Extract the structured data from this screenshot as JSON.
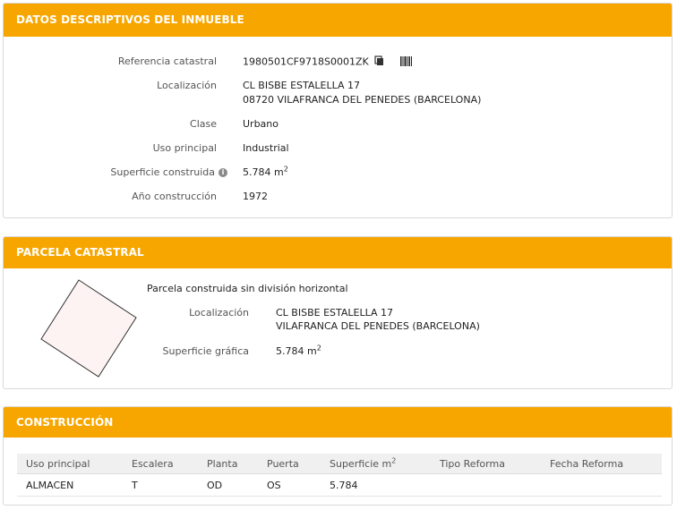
{
  "datos": {
    "title": "DATOS DESCRIPTIVOS DEL INMUEBLE",
    "ref_label": "Referencia catastral",
    "ref_value": "1980501CF9718S0001ZK",
    "loc_label": "Localización",
    "loc_line1": "CL BISBE ESTALELLA 17",
    "loc_line2": "08720 VILAFRANCA DEL PENEDES (BARCELONA)",
    "clase_label": "Clase",
    "clase_value": "Urbano",
    "uso_label": "Uso principal",
    "uso_value": "Industrial",
    "sup_label": "Superficie construida",
    "sup_value": "5.784 m",
    "sup_unit_exp": "2",
    "anio_label": "Año construcción",
    "anio_value": "1972"
  },
  "parcela": {
    "title": "PARCELA CATASTRAL",
    "desc": "Parcela construida sin división horizontal",
    "loc_label": "Localización",
    "loc_line1": "CL BISBE ESTALELLA 17",
    "loc_line2": "VILAFRANCA DEL PENEDES (BARCELONA)",
    "sup_label": "Superficie gráfica",
    "sup_value": "5.784 m",
    "sup_unit_exp": "2"
  },
  "construccion": {
    "title": "CONSTRUCCIÓN",
    "headers": [
      "Uso principal",
      "Escalera",
      "Planta",
      "Puerta",
      "Superficie m",
      "Tipo Reforma",
      "Fecha Reforma"
    ],
    "sup_header_exp": "2",
    "rows": [
      [
        "ALMACEN",
        "T",
        "OD",
        "OS",
        "5.784",
        "",
        ""
      ]
    ]
  },
  "icons": {
    "copy": "copy-icon",
    "barcode": "barcode-icon",
    "info": "info-icon"
  },
  "colors": {
    "header": "#f7a600",
    "parcel_fill": "#fdf3f3"
  }
}
